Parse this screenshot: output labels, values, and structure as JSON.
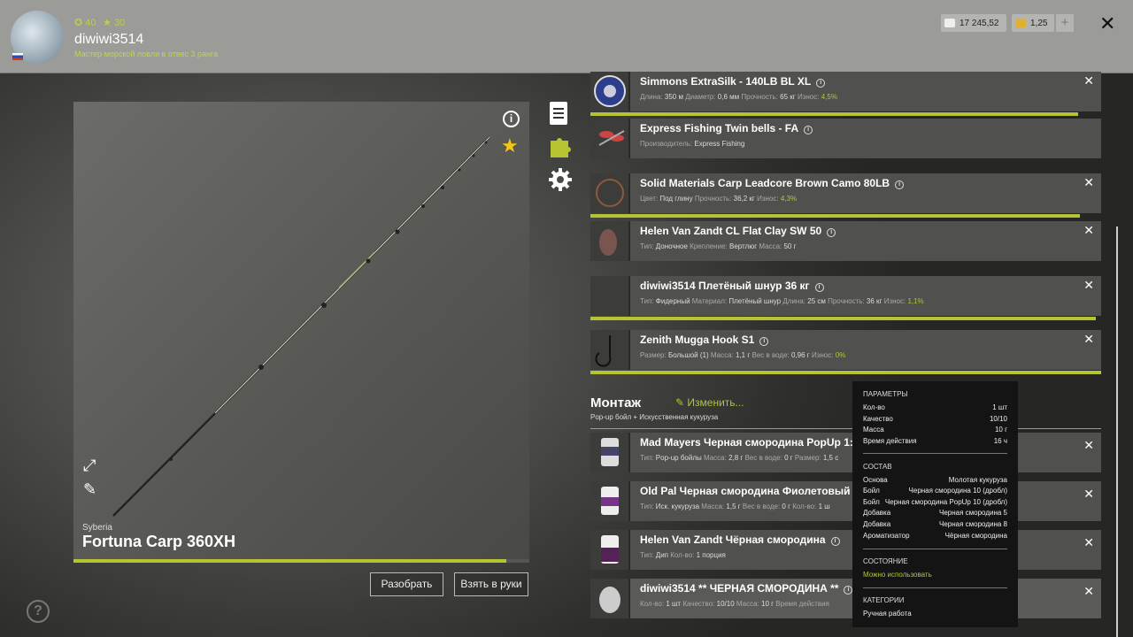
{
  "header": {
    "level": "40",
    "stars": "30",
    "username": "diwiwi3514",
    "title": "Мастер морской ловли в отвес 3 ранга",
    "currency_silver": "17 245,52",
    "currency_gold": "1,25",
    "plus_label": "+",
    "close_label": "✕"
  },
  "rod": {
    "brand": "Syberia",
    "name": "Fortuna Carp 360XH",
    "durability_fraction": 0.95,
    "disassemble_label": "Разобрать",
    "take_label": "Взять в руки"
  },
  "items": [
    {
      "name": "Simmons ExtraSilk - 140LB BL XL",
      "info": [
        [
          "Длина:",
          "350 м"
        ],
        [
          "Диаметр:",
          "0,6 мм"
        ],
        [
          "Прочность:",
          "65 кг"
        ],
        [
          "Износ:",
          "4,5%"
        ]
      ]
    },
    {
      "name": "Express Fishing Twin bells - FA",
      "info": [
        [
          "Производитель:",
          "Express Fishing"
        ]
      ]
    },
    {
      "name": "Solid Materials Carp Leadcore Brown Camo 80LB",
      "info": [
        [
          "Цвет:",
          "Под глину"
        ],
        [
          "Прочность:",
          "36,2 кг"
        ],
        [
          "Износ:",
          "4,3%"
        ]
      ]
    },
    {
      "name": "Helen Van Zandt CL Flat Clay SW 50",
      "info": [
        [
          "Тип:",
          "Доночное"
        ],
        [
          "Крепление:",
          "Вертлюг"
        ],
        [
          "Масса:",
          "50 г"
        ]
      ]
    },
    {
      "name": "diwiwi3514 Плетёный шнур 36 кг",
      "info": [
        [
          "Тип:",
          "Фидерный"
        ],
        [
          "Материал:",
          "Плетёный шнур"
        ],
        [
          "Длина:",
          "25 см"
        ],
        [
          "Прочность:",
          "36 кг"
        ],
        [
          "Износ:",
          "1,1%"
        ]
      ]
    },
    {
      "name": "Zenith Mugga Hook S1",
      "info": [
        [
          "Размер:",
          "Большой (1)"
        ],
        [
          "Масса:",
          "1,1 г"
        ],
        [
          "Вес в воде:",
          "0,96 г"
        ],
        [
          "Износ:",
          "0%"
        ]
      ]
    }
  ],
  "montage": {
    "title": "Монтаж",
    "edit_label": "Изменить...",
    "subtitle": "Pop-up бойл + Искусственная кукуруза"
  },
  "baits": [
    {
      "name": "Mad Mayers Черная смородина PopUp 1:",
      "info": [
        [
          "Тип:",
          "Pop-up бойлы"
        ],
        [
          "Масса:",
          "2,8 г"
        ],
        [
          "Вес в воде:",
          "0 г"
        ],
        [
          "Размер:",
          "1,5 с"
        ]
      ]
    },
    {
      "name": "Old Pal Черная смородина Фиолетовый",
      "info": [
        [
          "Тип:",
          "Иск. кукуруза"
        ],
        [
          "Масса:",
          "1,5 г"
        ],
        [
          "Вес в воде:",
          "0 г"
        ],
        [
          "Кол-во:",
          "1 ш"
        ]
      ]
    },
    {
      "name": "Helen Van Zandt Чёрная смородина",
      "info": [
        [
          "Тип:",
          "Дип"
        ],
        [
          "Кол-во:",
          "1 порция"
        ]
      ]
    },
    {
      "name": "diwiwi3514 ** ЧЕРНАЯ СМОРОДИНА **",
      "info": [
        [
          "Кол-во:",
          "1 шт"
        ],
        [
          "Качество:",
          "10/10"
        ],
        [
          "Масса:",
          "10 г"
        ],
        [
          "Время действия",
          ""
        ]
      ]
    }
  ],
  "tooltip": {
    "params_title": "ПАРАМЕТРЫ",
    "params": [
      [
        "Кол-во",
        "1 шт"
      ],
      [
        "Качество",
        "10/10"
      ],
      [
        "Масса",
        "10 г"
      ],
      [
        "Время действия",
        "16 ч"
      ]
    ],
    "composition_title": "СОСТАВ",
    "composition": [
      [
        "Основа",
        "Молотая кукуруза"
      ],
      [
        "Бойл",
        "Черная смородина 10 (дробл)"
      ],
      [
        "Бойл",
        "Черная смородина PopUp 10 (дробл)"
      ],
      [
        "Добавка",
        "Черная смородина 5"
      ],
      [
        "Добавка",
        "Черная смородина 8"
      ],
      [
        "Ароматизатор",
        "Чёрная смородина"
      ]
    ],
    "state_title": "СОСТОЯНИЕ",
    "state_value": "Можно использовать",
    "categories_title": "КАТЕГОРИИ",
    "categories_value": "Ручная работа"
  },
  "colors": {
    "accent": "#b7c431",
    "gold": "#f5c518"
  }
}
